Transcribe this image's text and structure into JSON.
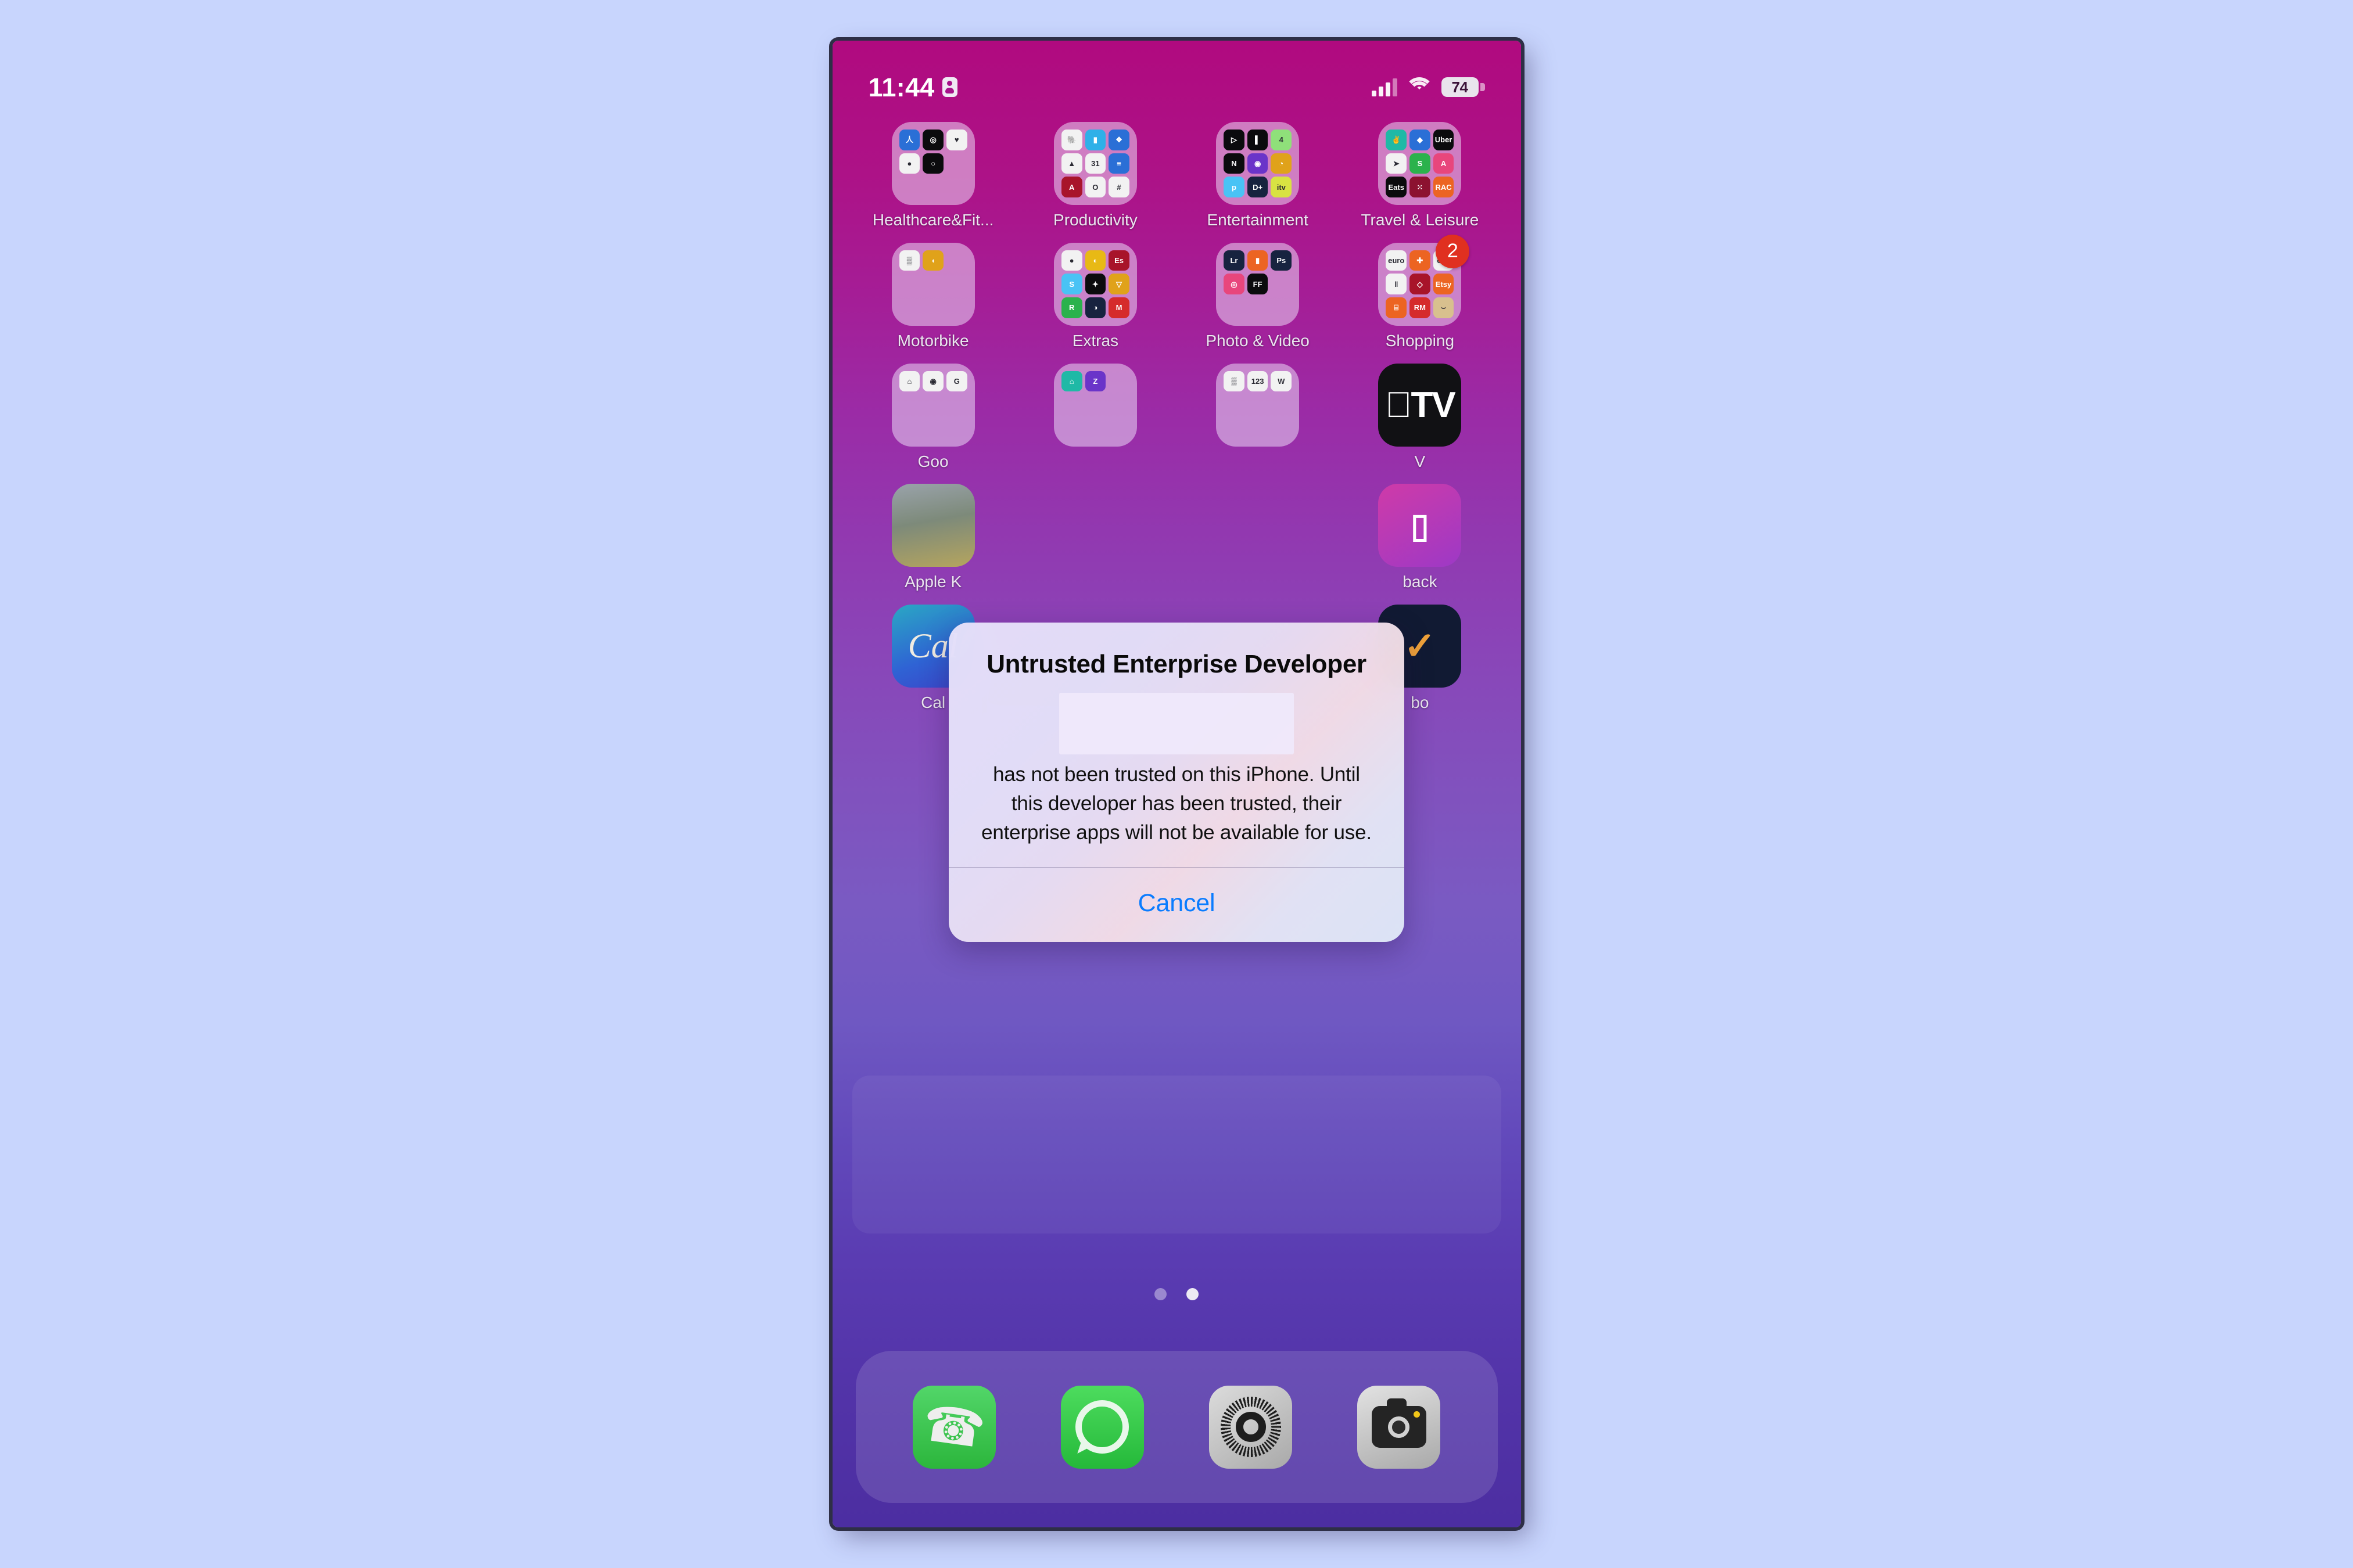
{
  "status_bar": {
    "time": "11:44",
    "battery_level": "74",
    "indicator_icon": "person-location-icon",
    "signal_icon": "cellular-signal-icon",
    "wifi_icon": "wifi-icon",
    "battery_icon": "battery-icon"
  },
  "home_screen": {
    "rows": [
      {
        "cells": [
          {
            "label": "Healthcare&Fit...",
            "type": "folder",
            "minis": [
              {
                "cls": "m-blue",
                "t": "人"
              },
              {
                "cls": "m-black",
                "t": "◎"
              },
              {
                "cls": "m-white",
                "t": "♥"
              },
              {
                "cls": "m-white",
                "t": "●"
              },
              {
                "cls": "m-black",
                "t": "○"
              },
              {
                "cls": "empty",
                "t": ""
              },
              {
                "cls": "empty",
                "t": ""
              },
              {
                "cls": "empty",
                "t": ""
              },
              {
                "cls": "empty",
                "t": ""
              }
            ]
          },
          {
            "label": "Productivity",
            "type": "folder",
            "minis": [
              {
                "cls": "m-white",
                "t": "🐘"
              },
              {
                "cls": "m-cyan",
                "t": "▮"
              },
              {
                "cls": "m-blue",
                "t": "❖"
              },
              {
                "cls": "m-white",
                "t": "▲"
              },
              {
                "cls": "m-white",
                "t": "31"
              },
              {
                "cls": "m-blue",
                "t": "≡"
              },
              {
                "cls": "m-deepred",
                "t": "A"
              },
              {
                "cls": "m-white",
                "t": "O"
              },
              {
                "cls": "m-white",
                "t": "#"
              }
            ]
          },
          {
            "label": "Entertainment",
            "type": "folder",
            "minis": [
              {
                "cls": "m-black",
                "t": "▷"
              },
              {
                "cls": "m-black",
                "t": "▌"
              },
              {
                "cls": "m-lightgreen",
                "t": "4"
              },
              {
                "cls": "m-black",
                "t": "N"
              },
              {
                "cls": "m-violet",
                "t": "◉"
              },
              {
                "cls": "m-gold",
                "t": "◔"
              },
              {
                "cls": "m-sky",
                "t": "p"
              },
              {
                "cls": "m-navy",
                "t": "D+"
              },
              {
                "cls": "m-lime",
                "t": "itv"
              }
            ]
          },
          {
            "label": "Travel & Leisure",
            "type": "folder",
            "minis": [
              {
                "cls": "m-teal",
                "t": "✌"
              },
              {
                "cls": "m-blue",
                "t": "◆"
              },
              {
                "cls": "m-black",
                "t": "Uber"
              },
              {
                "cls": "m-white",
                "t": "➤"
              },
              {
                "cls": "m-green",
                "t": "S"
              },
              {
                "cls": "m-pink",
                "t": "A"
              },
              {
                "cls": "m-black",
                "t": "Eats"
              },
              {
                "cls": "m-maroon",
                "t": "⁙"
              },
              {
                "cls": "m-orange",
                "t": "RAC"
              }
            ]
          }
        ]
      },
      {
        "cells": [
          {
            "label": "Motorbike",
            "type": "folder",
            "minis": [
              {
                "cls": "m-white",
                "t": "▒"
              },
              {
                "cls": "m-gold",
                "t": "◖"
              },
              {
                "cls": "empty",
                "t": ""
              },
              {
                "cls": "empty",
                "t": ""
              },
              {
                "cls": "empty",
                "t": ""
              },
              {
                "cls": "empty",
                "t": ""
              },
              {
                "cls": "empty",
                "t": ""
              },
              {
                "cls": "empty",
                "t": ""
              },
              {
                "cls": "empty",
                "t": ""
              }
            ]
          },
          {
            "label": "Extras",
            "type": "folder",
            "minis": [
              {
                "cls": "m-white",
                "t": "●"
              },
              {
                "cls": "m-yellow",
                "t": "◐"
              },
              {
                "cls": "m-deepred",
                "t": "Es"
              },
              {
                "cls": "m-sky",
                "t": "S"
              },
              {
                "cls": "m-black",
                "t": "✦"
              },
              {
                "cls": "m-gold",
                "t": "▽"
              },
              {
                "cls": "m-green",
                "t": "R"
              },
              {
                "cls": "m-navy",
                "t": "◑"
              },
              {
                "cls": "m-red",
                "t": "M"
              }
            ]
          },
          {
            "label": "Photo & Video",
            "type": "folder",
            "minis": [
              {
                "cls": "m-navy",
                "t": "Lr"
              },
              {
                "cls": "m-orange",
                "t": "▮"
              },
              {
                "cls": "m-navy",
                "t": "Ps"
              },
              {
                "cls": "m-pink",
                "t": "◎"
              },
              {
                "cls": "m-black",
                "t": "FF"
              },
              {
                "cls": "empty",
                "t": ""
              },
              {
                "cls": "empty",
                "t": ""
              },
              {
                "cls": "empty",
                "t": ""
              },
              {
                "cls": "empty",
                "t": ""
              }
            ]
          },
          {
            "label": "Shopping",
            "type": "folder",
            "badge": "2",
            "minis": [
              {
                "cls": "m-white",
                "t": "euro"
              },
              {
                "cls": "m-orange",
                "t": "✚"
              },
              {
                "cls": "m-white",
                "t": "eby"
              },
              {
                "cls": "m-white",
                "t": "‖"
              },
              {
                "cls": "m-deepred",
                "t": "◇"
              },
              {
                "cls": "m-orange",
                "t": "Etsy"
              },
              {
                "cls": "m-orange",
                "t": "⌸"
              },
              {
                "cls": "m-red",
                "t": "RM"
              },
              {
                "cls": "m-tan",
                "t": "⌣"
              }
            ]
          }
        ]
      },
      {
        "cells": [
          {
            "label": "Goo",
            "type": "folder",
            "truncated": true,
            "minis": [
              {
                "cls": "m-white",
                "t": "⌂"
              },
              {
                "cls": "m-white",
                "t": "◉"
              },
              {
                "cls": "m-white",
                "t": "G"
              },
              {
                "cls": "empty",
                "t": ""
              },
              {
                "cls": "empty",
                "t": ""
              },
              {
                "cls": "empty",
                "t": ""
              },
              {
                "cls": "empty",
                "t": ""
              },
              {
                "cls": "empty",
                "t": ""
              },
              {
                "cls": "empty",
                "t": ""
              }
            ]
          },
          {
            "label": "",
            "type": "folder",
            "minis": [
              {
                "cls": "m-teal",
                "t": "⌂"
              },
              {
                "cls": "m-violet",
                "t": "Z"
              },
              {
                "cls": "empty",
                "t": ""
              },
              {
                "cls": "empty",
                "t": ""
              },
              {
                "cls": "empty",
                "t": ""
              },
              {
                "cls": "empty",
                "t": ""
              },
              {
                "cls": "empty",
                "t": ""
              },
              {
                "cls": "empty",
                "t": ""
              },
              {
                "cls": "empty",
                "t": ""
              }
            ]
          },
          {
            "label": "",
            "type": "folder",
            "minis": [
              {
                "cls": "m-white",
                "t": "▒"
              },
              {
                "cls": "m-white",
                "t": "123"
              },
              {
                "cls": "m-white",
                "t": "W"
              },
              {
                "cls": "empty",
                "t": ""
              },
              {
                "cls": "empty",
                "t": ""
              },
              {
                "cls": "empty",
                "t": ""
              },
              {
                "cls": "empty",
                "t": ""
              },
              {
                "cls": "empty",
                "t": ""
              },
              {
                "cls": "empty",
                "t": ""
              }
            ]
          },
          {
            "label": "V",
            "type": "app",
            "app_style": "appletv",
            "glyph": "TV",
            "truncated": true
          }
        ]
      },
      {
        "cells": [
          {
            "label": "Apple K",
            "type": "app",
            "app_style": "pixelgame",
            "glyph": "",
            "truncated": true
          },
          {
            "label": "",
            "type": "hidden"
          },
          {
            "label": "",
            "type": "hidden"
          },
          {
            "label": "back",
            "type": "app",
            "app_style": "magenta-app",
            "glyph": "▯",
            "truncated": true
          }
        ]
      },
      {
        "cells": [
          {
            "label": "Cal",
            "type": "app",
            "app_style": "calm",
            "glyph": "Cal",
            "truncated": true
          },
          {
            "label": "",
            "type": "hidden"
          },
          {
            "label": "",
            "type": "hidden"
          },
          {
            "label": "bo",
            "type": "app",
            "app_style": "navy-app",
            "glyph": "✓",
            "truncated": true
          }
        ]
      }
    ],
    "page_dots": {
      "count": 2,
      "active_index": 1
    }
  },
  "dock": {
    "items": [
      {
        "label": "Phone",
        "icon": "phone-icon"
      },
      {
        "label": "WhatsApp",
        "icon": "whatsapp-icon"
      },
      {
        "label": "Settings",
        "icon": "settings-gear-icon"
      },
      {
        "label": "Camera",
        "icon": "camera-icon"
      }
    ]
  },
  "alert": {
    "title": "Untrusted Enterprise Developer",
    "redacted_developer_name": "",
    "message": "has not been trusted on this iPhone. Until this developer has been trusted, their enterprise apps will not be available for use.",
    "cancel_label": "Cancel",
    "accent_color": "#0a7cff"
  }
}
